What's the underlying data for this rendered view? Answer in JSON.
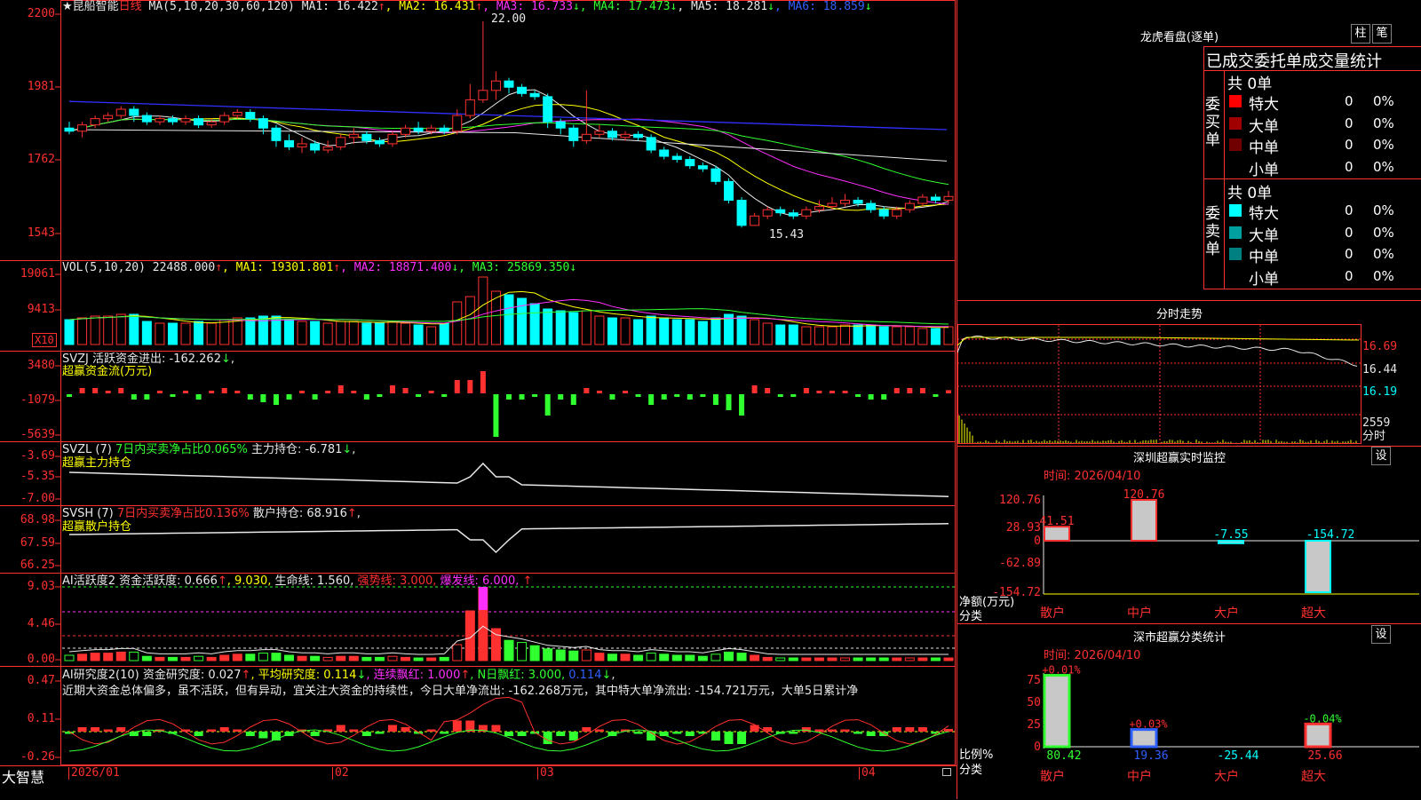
{
  "stock": {
    "name": "★昆船智能",
    "period": "日线"
  },
  "ma_legend": [
    {
      "t": "MA(5,10,20,30,60,120)",
      "c": "#e8e8e8"
    },
    {
      "t": " MA1: 16.422",
      "c": "#e8e8e8"
    },
    {
      "t": "↑",
      "c": "#ff3030"
    },
    {
      "t": ", MA2: 16.431",
      "c": "#ffff00"
    },
    {
      "t": "↑",
      "c": "#ff3030"
    },
    {
      "t": ", MA3: 16.733",
      "c": "#ff30ff"
    },
    {
      "t": "↓",
      "c": "#30ff30"
    },
    {
      "t": ", MA4: 17.473",
      "c": "#30ff30"
    },
    {
      "t": "↓",
      "c": "#30ff30"
    },
    {
      "t": ", MA5: 18.281",
      "c": "#e8e8e8"
    },
    {
      "t": "↓",
      "c": "#30ff30"
    },
    {
      "t": ", MA6: 18.859",
      "c": "#3060ff"
    },
    {
      "t": "↓",
      "c": "#30ff30"
    }
  ],
  "price_axis": [
    "2200",
    "1981",
    "1762",
    "1543"
  ],
  "high_label": "22.00",
  "low_label": "15.43",
  "vol_legend": [
    {
      "t": "VOL(5,10,20) ",
      "c": "#e8e8e8"
    },
    {
      "t": "22488.000",
      "c": "#e8e8e8"
    },
    {
      "t": "↑",
      "c": "#ff3030"
    },
    {
      "t": ", MA1: 19301.801",
      "c": "#ffff00"
    },
    {
      "t": "↑",
      "c": "#ff3030"
    },
    {
      "t": ", MA2: 18871.400",
      "c": "#ff30ff"
    },
    {
      "t": "↓",
      "c": "#30ff30"
    },
    {
      "t": ", MA3: 25869.350",
      "c": "#30ff30"
    },
    {
      "t": "↓",
      "c": "#30ff30"
    }
  ],
  "vol_axis": [
    "19061",
    "9413"
  ],
  "vol_unit": "X10",
  "svzj": {
    "line1": [
      {
        "t": "SVZJ  活跃资金进出: -162.262",
        "c": "#e8e8e8"
      },
      {
        "t": "↓",
        "c": "#30ff30"
      },
      {
        "t": ",",
        "c": "#e8e8e8"
      }
    ],
    "line2": "超赢资金流(万元)",
    "axis": [
      "3480",
      "-1079",
      "-5639"
    ]
  },
  "svzl": {
    "line1": [
      {
        "t": "SVZL (7) ",
        "c": "#e8e8e8"
      },
      {
        "t": "7日内买卖净占比0.065%",
        "c": "#30ff30"
      },
      {
        "t": " 主力持仓: -6.781",
        "c": "#e8e8e8"
      },
      {
        "t": "↓",
        "c": "#30ff30"
      },
      {
        "t": ",",
        "c": "#e8e8e8"
      }
    ],
    "line2": "超赢主力持仓",
    "axis": [
      "-3.69",
      "-5.35",
      "-7.00"
    ]
  },
  "svsh": {
    "line1": [
      {
        "t": "SVSH (7) ",
        "c": "#e8e8e8"
      },
      {
        "t": "7日内买卖净占比0.136%",
        "c": "#ff3030"
      },
      {
        "t": " 散户持仓: 68.916",
        "c": "#e8e8e8"
      },
      {
        "t": "↑",
        "c": "#ff3030"
      },
      {
        "t": ",",
        "c": "#e8e8e8"
      }
    ],
    "line2": "超赢散户持仓",
    "axis": [
      "68.98",
      "67.59",
      "66.25"
    ]
  },
  "ai_active": {
    "line1": [
      {
        "t": "AI活跃度2 资金活跃度: 0.666",
        "c": "#e8e8e8"
      },
      {
        "t": "↑",
        "c": "#ff3030"
      },
      {
        "t": ", 9.030, ",
        "c": "#ffff00"
      },
      {
        "t": "生命线: 1.560, ",
        "c": "#e8e8e8"
      },
      {
        "t": "强势线: 3.000, ",
        "c": "#ff3030"
      },
      {
        "t": "爆发线: 6.000,",
        "c": "#ff30ff"
      },
      {
        "t": "         ↑",
        "c": "#ff3030"
      }
    ],
    "axis": [
      "9.03",
      "4.46",
      "0.00"
    ]
  },
  "ai_research": {
    "line1": [
      {
        "t": "AI研究度2(10) 资金研究度: 0.027",
        "c": "#e8e8e8"
      },
      {
        "t": "↑",
        "c": "#ff3030"
      },
      {
        "t": ", 平均研究度: 0.114",
        "c": "#ffff00"
      },
      {
        "t": "↓",
        "c": "#30ff30"
      },
      {
        "t": ", 连续飘红: 1.000",
        "c": "#ff30ff"
      },
      {
        "t": "↑",
        "c": "#ff3030"
      },
      {
        "t": ", N日飘红: 3.000, ",
        "c": "#30ff30"
      },
      {
        "t": "0.114",
        "c": "#3060ff"
      },
      {
        "t": "↓",
        "c": "#30ff30"
      },
      {
        "t": ",",
        "c": "#e8e8e8"
      }
    ],
    "line2": "近期大资金总体偏多，虽不活跃，但有异动，宜关注大资金的持续性，今日大单净流出: -162.268万元，其中特大单净流出: -154.721万元，大单5日累计净",
    "axis": [
      "0.47",
      "0.11",
      "-0.26"
    ]
  },
  "xaxis": {
    "brand": "大智慧",
    "labels": [
      "2026/01",
      "02",
      "03",
      "04"
    ]
  },
  "lhb": {
    "title": "龙虎看盘(逐单)",
    "btn1": "柱",
    "btn2": "笔",
    "header": "已成交委托单成交量统计",
    "buy": {
      "side": "委买单",
      "total": "共 0单",
      "rows": [
        {
          "label": "特大",
          "val": "0",
          "pct": "0%",
          "c": "#ff0000"
        },
        {
          "label": "大单",
          "val": "0",
          "pct": "0%",
          "c": "#a00000"
        },
        {
          "label": "中单",
          "val": "0",
          "pct": "0%",
          "c": "#700000"
        },
        {
          "label": "小单",
          "val": "0",
          "pct": "0%",
          "c": "#000000"
        }
      ]
    },
    "sell": {
      "side": "委卖单",
      "total": "共 0单",
      "rows": [
        {
          "label": "特大",
          "val": "0",
          "pct": "0%",
          "c": "#00ffff"
        },
        {
          "label": "大单",
          "val": "0",
          "pct": "0%",
          "c": "#00a0a0"
        },
        {
          "label": "中单",
          "val": "0",
          "pct": "0%",
          "c": "#008080"
        },
        {
          "label": "小单",
          "val": "0",
          "pct": "0%",
          "c": "#000000"
        }
      ]
    }
  },
  "intraday": {
    "title": "分时走势",
    "labels": [
      "16.69",
      "16.44",
      "16.19"
    ],
    "vol_label": "2559",
    "vol_unit": "分时"
  },
  "monitor": {
    "title": "深圳超赢实时监控",
    "btn": "设",
    "time": "时间: 2026/04/10",
    "axis": [
      "120.76",
      "28.93",
      "0",
      "-62.89",
      "-154.72"
    ],
    "ylabel": "净额(万元)",
    "xlabel": "分类",
    "bars": [
      {
        "cat": "散户",
        "val": 41.51,
        "label": "41.51"
      },
      {
        "cat": "中户",
        "val": 120.76,
        "label": "120.76"
      },
      {
        "cat": "大户",
        "val": -7.55,
        "label": "-7.55"
      },
      {
        "cat": "超大",
        "val": -154.72,
        "label": "-154.72"
      }
    ]
  },
  "classify": {
    "title": "深市超赢分类统计",
    "btn": "设",
    "time": "时间: 2026/04/10",
    "axis": [
      "75",
      "50",
      "25",
      "0"
    ],
    "ylabel": "比例%",
    "xlabel": "分类",
    "bars": [
      {
        "cat": "散户",
        "top": "+0.01%",
        "val": 80.42,
        "label": "80.42",
        "tc": "#ff3030",
        "lc": "#30ff30"
      },
      {
        "cat": "中户",
        "top": "+0.03%",
        "val": 19.36,
        "label": "19.36",
        "tc": "#ff3030",
        "lc": "#3060ff"
      },
      {
        "cat": "大户",
        "top": "",
        "val": 0,
        "label": "-25.44",
        "tc": "#ff3030",
        "lc": "#00ffff"
      },
      {
        "cat": "超大",
        "top": "-0.04%",
        "val": 25.66,
        "label": "25.66",
        "tc": "#30ff30",
        "lc": "#ff3030"
      }
    ]
  },
  "chart_data": {
    "type": "candlestick",
    "candles": [
      [
        18.6,
        18.5,
        18.8,
        18.4
      ],
      [
        18.5,
        18.7,
        18.8,
        18.3
      ],
      [
        18.7,
        18.9,
        19.0,
        18.6
      ],
      [
        18.9,
        19.0,
        19.1,
        18.8
      ],
      [
        19.0,
        19.2,
        19.3,
        18.9
      ],
      [
        19.2,
        19.0,
        19.3,
        18.8
      ],
      [
        19.0,
        18.8,
        19.1,
        18.7
      ],
      [
        18.8,
        18.9,
        19.0,
        18.7
      ],
      [
        18.9,
        18.8,
        19.0,
        18.7
      ],
      [
        18.8,
        18.9,
        19.0,
        18.7
      ],
      [
        18.9,
        18.7,
        19.0,
        18.6
      ],
      [
        18.7,
        18.8,
        18.9,
        18.6
      ],
      [
        18.8,
        19.0,
        19.1,
        18.7
      ],
      [
        19.0,
        19.1,
        19.2,
        18.9
      ],
      [
        19.1,
        18.9,
        19.2,
        18.8
      ],
      [
        18.9,
        18.6,
        19.0,
        18.4
      ],
      [
        18.6,
        18.2,
        18.7,
        18.0
      ],
      [
        18.2,
        18.0,
        18.4,
        17.9
      ],
      [
        18.0,
        18.1,
        18.3,
        17.8
      ],
      [
        18.1,
        17.9,
        18.2,
        17.8
      ],
      [
        17.9,
        18.0,
        18.2,
        17.8
      ],
      [
        18.0,
        18.3,
        18.4,
        17.9
      ],
      [
        18.3,
        18.4,
        18.6,
        18.1
      ],
      [
        18.4,
        18.2,
        18.5,
        18.1
      ],
      [
        18.2,
        18.1,
        18.3,
        18.0
      ],
      [
        18.1,
        18.4,
        18.5,
        18.0
      ],
      [
        18.4,
        18.6,
        18.7,
        18.3
      ],
      [
        18.6,
        18.5,
        18.8,
        18.4
      ],
      [
        18.5,
        18.6,
        18.7,
        18.4
      ],
      [
        18.6,
        18.5,
        18.7,
        18.4
      ],
      [
        18.5,
        19.0,
        19.2,
        18.4
      ],
      [
        19.0,
        19.5,
        20.0,
        18.9
      ],
      [
        19.5,
        19.8,
        22.0,
        19.4
      ],
      [
        19.8,
        20.1,
        20.4,
        19.5
      ],
      [
        20.1,
        19.9,
        20.2,
        19.7
      ],
      [
        19.9,
        19.7,
        20.0,
        19.6
      ],
      [
        19.7,
        19.6,
        19.8,
        19.5
      ],
      [
        19.6,
        18.8,
        19.7,
        18.6
      ],
      [
        18.8,
        18.6,
        18.9,
        18.4
      ],
      [
        18.6,
        18.2,
        18.7,
        18.0
      ],
      [
        18.2,
        18.4,
        19.8,
        18.1
      ],
      [
        18.4,
        18.5,
        18.7,
        18.3
      ],
      [
        18.5,
        18.3,
        18.6,
        18.2
      ],
      [
        18.3,
        18.4,
        18.5,
        18.2
      ],
      [
        18.4,
        18.3,
        18.5,
        18.2
      ],
      [
        18.3,
        17.9,
        18.4,
        17.8
      ],
      [
        17.9,
        17.7,
        18.0,
        17.6
      ],
      [
        17.7,
        17.6,
        17.8,
        17.5
      ],
      [
        17.6,
        17.4,
        17.7,
        17.3
      ],
      [
        17.4,
        17.3,
        17.5,
        17.2
      ],
      [
        17.3,
        16.9,
        17.4,
        16.8
      ],
      [
        16.9,
        16.3,
        17.0,
        16.2
      ],
      [
        16.3,
        15.5,
        16.4,
        15.43
      ],
      [
        15.5,
        15.8,
        15.9,
        15.5
      ],
      [
        15.8,
        16.0,
        16.1,
        15.7
      ],
      [
        16.0,
        15.9,
        16.1,
        15.8
      ],
      [
        15.9,
        15.8,
        16.0,
        15.7
      ],
      [
        15.8,
        16.0,
        16.1,
        15.7
      ],
      [
        16.0,
        16.1,
        16.3,
        15.9
      ],
      [
        16.1,
        16.2,
        16.4,
        16.0
      ],
      [
        16.2,
        16.3,
        16.5,
        16.1
      ],
      [
        16.3,
        16.2,
        16.4,
        16.1
      ],
      [
        16.2,
        16.0,
        16.3,
        15.9
      ],
      [
        16.0,
        15.8,
        16.1,
        15.7
      ],
      [
        15.8,
        16.0,
        16.1,
        15.7
      ],
      [
        16.0,
        16.2,
        16.3,
        15.9
      ],
      [
        16.2,
        16.4,
        16.5,
        16.1
      ],
      [
        16.4,
        16.3,
        16.5,
        16.2
      ],
      [
        16.3,
        16.42,
        16.6,
        16.2
      ]
    ],
    "volume": [
      14,
      15,
      16,
      16,
      17,
      17,
      13,
      12,
      12,
      12,
      13,
      12,
      14,
      15,
      15,
      16,
      16,
      14,
      13,
      13,
      12,
      13,
      13,
      12,
      12,
      13,
      12,
      11,
      10,
      12,
      24,
      27,
      38,
      30,
      28,
      26,
      23,
      20,
      19,
      18,
      19,
      16,
      15,
      15,
      14,
      16,
      15,
      14,
      14,
      13,
      15,
      17,
      16,
      14,
      12,
      11,
      11,
      10,
      10,
      10,
      11,
      11,
      11,
      10,
      10,
      10,
      9,
      9,
      10
    ],
    "ylim": [
      15.0,
      22.2
    ],
    "x_labels": [
      "2026/01",
      "02",
      "03",
      "04"
    ]
  }
}
